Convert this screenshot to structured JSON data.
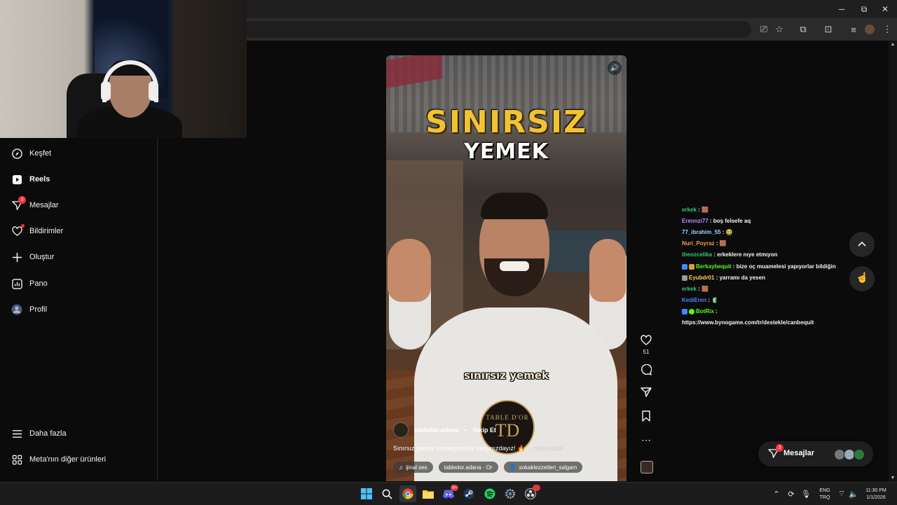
{
  "window_controls": {
    "minimize": "─",
    "restore": "⧉",
    "close": "✕"
  },
  "toolbar_icons": [
    "cast-icon",
    "star-icon",
    "extensions-icon",
    "search-tabs-icon",
    "playlist-icon",
    "profile-avatar",
    "kebab-menu-icon"
  ],
  "sidebar": {
    "items": [
      {
        "label": "Keşfet",
        "icon": "compass-icon"
      },
      {
        "label": "Reels",
        "icon": "reels-icon",
        "active": true
      },
      {
        "label": "Mesajlar",
        "icon": "messenger-icon",
        "badge": "3"
      },
      {
        "label": "Bildirimler",
        "icon": "heart-icon",
        "dot": true
      },
      {
        "label": "Oluştur",
        "icon": "plus-icon"
      },
      {
        "label": "Pano",
        "icon": "dashboard-icon"
      },
      {
        "label": "Profil",
        "icon": "profile-avatar"
      }
    ],
    "bottom_items": [
      {
        "label": "Daha fazla",
        "icon": "menu-icon"
      },
      {
        "label": "Meta'nın diğer ürünleri",
        "icon": "grid-icon"
      }
    ]
  },
  "reel": {
    "overlay_title_1": "SINIRSIZ",
    "overlay_title_2": "YEMEK",
    "subtitle": "sınırsız yemek",
    "logo_text": "TABLE D'OR",
    "logo_mark": "TD",
    "author": "tabledor.adana",
    "separator": "•",
    "follow_label": "Takip Et",
    "caption": "Sınırsız yemek konseptimizle karşınızdayız! 🔥",
    "caption_more": "... daha fazla",
    "audio_label": "ijinal ses",
    "location_chip": "tabledor.adana · Or",
    "tagged_user": "sokaklezzetleri_salgam"
  },
  "actions": {
    "like_count": "51"
  },
  "chat": [
    {
      "user": "erkek",
      "user_color": "#34c77b",
      "text": "🟫"
    },
    {
      "user": "Erennzi77",
      "user_color": "#b98cff",
      "text": "boş felsefe aq"
    },
    {
      "user": "77_ibrahim_55",
      "user_color": "#9fd3ff",
      "text": "🤮"
    },
    {
      "user": "Nuri_Poyraz",
      "user_color": "#ff9b3d",
      "text": "🟫"
    },
    {
      "user": "theozcelika",
      "user_color": "#34c77b",
      "text": "erkeklere nıye etmıyon"
    },
    {
      "user": "Berkaybequit",
      "user_color": "#53fc18",
      "text": "bize oç muamelesi yapıyorlar bildiğin",
      "badges": true
    },
    {
      "user": "Eyubdr01",
      "user_color": "#ffd24a",
      "text": "yarramı da yesen",
      "badge_one": true
    },
    {
      "user": "erkek",
      "user_color": "#34c77b",
      "text": "🟫"
    },
    {
      "user": "KediEren",
      "user_color": "#3d8bff",
      "text": "🧃"
    },
    {
      "user": "BotRix",
      "user_color": "#53fc18",
      "text": "",
      "badges": true
    },
    {
      "user": "",
      "user_color": "#ffffff",
      "text": "https://www.bynogame.com/tr/destekle/canbequit"
    }
  ],
  "messages_pill": {
    "label": "Mesajlar",
    "badge": "3"
  },
  "taskbar": {
    "apps": [
      "windows-start-icon",
      "search-icon",
      "chrome-icon",
      "file-explorer-icon",
      "discord-icon",
      "steam-icon",
      "spotify-icon",
      "settings-icon",
      "obs-icon"
    ],
    "discord_badge": "9+",
    "lang_1": "ENG",
    "lang_2": "TRQ",
    "time": "11:30 PM",
    "date": "1/1/2026"
  },
  "colors": {
    "accent_badge": "#ff3040",
    "reel_title": "#f1c233",
    "kick_green": "#53fc18"
  }
}
